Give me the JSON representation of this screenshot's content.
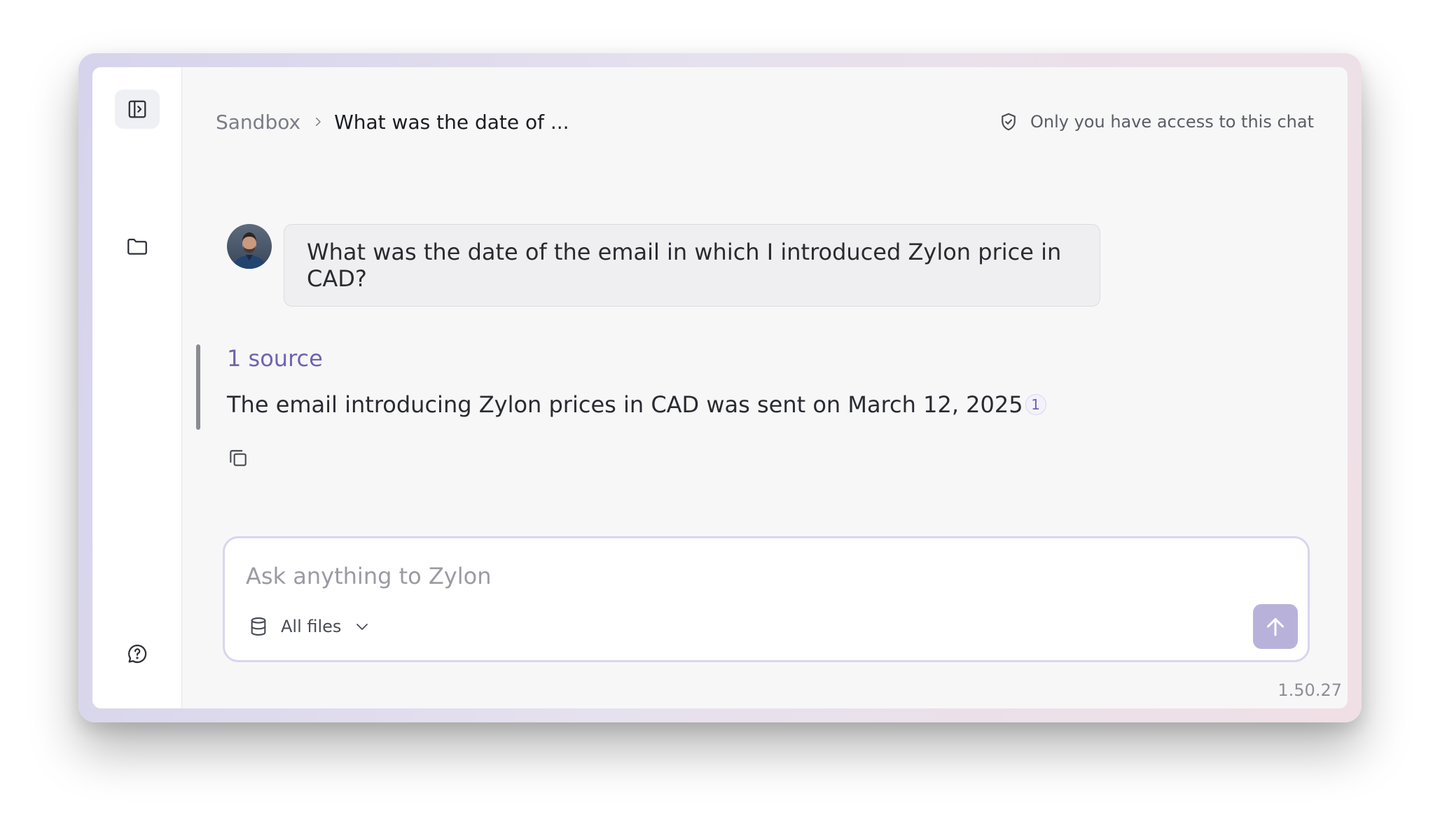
{
  "breadcrumb": {
    "root": "Sandbox",
    "current": "What was the date of ..."
  },
  "access_notice": "Only you have access to this chat",
  "conversation": {
    "question": "What was the date of the email in which I introduced Zylon price in CAD?",
    "sources_label": "1 source",
    "answer": "The email introducing Zylon prices in CAD was sent on March 12, 2025",
    "citation": "1"
  },
  "composer": {
    "placeholder": "Ask anything to Zylon",
    "files_selector": "All files"
  },
  "version": "1.50.27",
  "icons": {
    "sidebar_toggle": "sidebar-toggle-icon",
    "folder": "folder-icon",
    "help": "chat-help-icon",
    "shield": "shield-check-icon",
    "copy": "copy-icon",
    "database": "database-icon",
    "chevron": "chevron-down-icon",
    "send": "arrow-up-icon"
  },
  "colors": {
    "accent": "#6f63b2",
    "send_button": "#b8b2db",
    "composer_border": "#d9d5ef"
  }
}
